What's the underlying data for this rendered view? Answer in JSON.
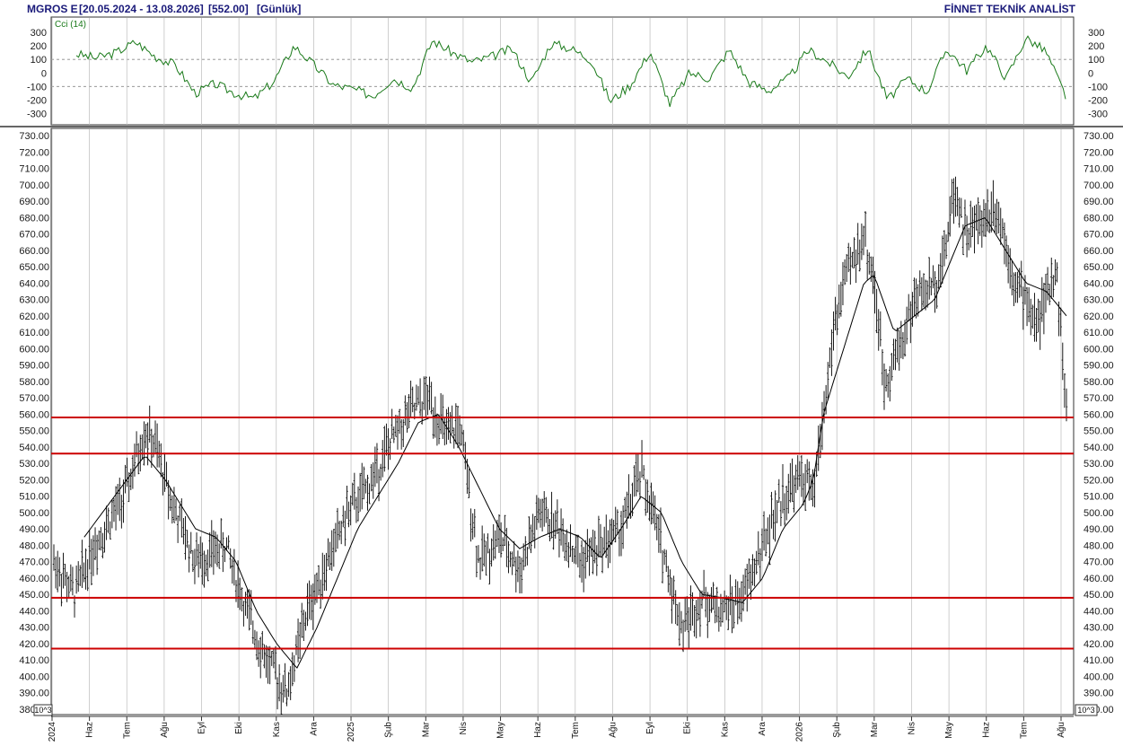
{
  "header": {
    "symbol": "MGROS E",
    "range": "[20.05.2024 - 13.08.2026]",
    "last": "[552.00]",
    "period": "[Günlük]",
    "brand": "FİNNET TEKNİK ANALİST"
  },
  "chart_data": [
    {
      "type": "line",
      "indicator_label": "Cci (14)",
      "ylim": [
        -350,
        380
      ],
      "yticks": [
        300,
        200,
        100,
        0,
        -100,
        -200,
        -300
      ],
      "reference_lines": [
        100,
        -100
      ],
      "series": [
        {
          "name": "Cci (14)",
          "color": "#1a7a1a",
          "points": [
            [
              0,
              140
            ],
            [
              0.02,
              110
            ],
            [
              0.04,
              150
            ],
            [
              0.06,
              230
            ],
            [
              0.08,
              120
            ],
            [
              0.1,
              60
            ],
            [
              0.12,
              -150
            ],
            [
              0.14,
              -80
            ],
            [
              0.16,
              -150
            ],
            [
              0.18,
              -190
            ],
            [
              0.2,
              -60
            ],
            [
              0.22,
              200
            ],
            [
              0.24,
              60
            ],
            [
              0.26,
              -90
            ],
            [
              0.28,
              -120
            ],
            [
              0.3,
              -170
            ],
            [
              0.32,
              -40
            ],
            [
              0.34,
              -110
            ],
            [
              0.36,
              240
            ],
            [
              0.38,
              150
            ],
            [
              0.4,
              80
            ],
            [
              0.42,
              120
            ],
            [
              0.44,
              180
            ],
            [
              0.46,
              -70
            ],
            [
              0.48,
              220
            ],
            [
              0.5,
              180
            ],
            [
              0.52,
              100
            ],
            [
              0.54,
              -210
            ],
            [
              0.56,
              -90
            ],
            [
              0.58,
              160
            ],
            [
              0.6,
              -230
            ],
            [
              0.62,
              0
            ],
            [
              0.64,
              -40
            ],
            [
              0.66,
              170
            ],
            [
              0.68,
              -70
            ],
            [
              0.7,
              -130
            ],
            [
              0.72,
              -40
            ],
            [
              0.74,
              170
            ],
            [
              0.76,
              80
            ],
            [
              0.78,
              -30
            ],
            [
              0.8,
              180
            ],
            [
              0.82,
              -200
            ],
            [
              0.84,
              -40
            ],
            [
              0.86,
              -140
            ],
            [
              0.88,
              180
            ],
            [
              0.9,
              20
            ],
            [
              0.92,
              200
            ],
            [
              0.94,
              -40
            ],
            [
              0.96,
              260
            ],
            [
              0.98,
              160
            ],
            [
              1.0,
              -170
            ]
          ]
        }
      ]
    },
    {
      "type": "bar",
      "style": "ohlc",
      "unit_label": "10^3",
      "ylim": [
        380,
        732
      ],
      "yticks": [
        730,
        720,
        710,
        700,
        690,
        680,
        670,
        660,
        650,
        640,
        630,
        620,
        610,
        600,
        590,
        580,
        570,
        560,
        550,
        540,
        530,
        520,
        510,
        500,
        490,
        480,
        470,
        460,
        450,
        440,
        430,
        420,
        410,
        400,
        390,
        380
      ],
      "horizontal_lines": [
        {
          "y": 558,
          "color": "#cc0000"
        },
        {
          "y": 536,
          "color": "#cc0000"
        },
        {
          "y": 448,
          "color": "#cc0000"
        },
        {
          "y": 417,
          "color": "#cc0000"
        }
      ],
      "x_labels": [
        "2024",
        "Haz",
        "Tem",
        "Ağu",
        "Eyl",
        "Eki",
        "Kas",
        "Ara",
        "2025",
        "Şub",
        "Mar",
        "Nis",
        "May",
        "Haz",
        "Tem",
        "Ağu",
        "Eyl",
        "Eki",
        "Kas",
        "Ara",
        "2026",
        "Şub",
        "Mar",
        "Nis",
        "May",
        "Haz",
        "Tem",
        "Ağu"
      ],
      "price_anchors": [
        [
          0,
          470
        ],
        [
          0.02,
          450
        ],
        [
          0.04,
          480
        ],
        [
          0.07,
          510
        ],
        [
          0.09,
          550
        ],
        [
          0.1,
          540
        ],
        [
          0.12,
          500
        ],
        [
          0.14,
          470
        ],
        [
          0.17,
          480
        ],
        [
          0.19,
          440
        ],
        [
          0.21,
          410
        ],
        [
          0.23,
          390
        ],
        [
          0.25,
          440
        ],
        [
          0.27,
          470
        ],
        [
          0.29,
          500
        ],
        [
          0.31,
          515
        ],
        [
          0.33,
          540
        ],
        [
          0.35,
          560
        ],
        [
          0.37,
          570
        ],
        [
          0.39,
          545
        ],
        [
          0.4,
          555
        ],
        [
          0.42,
          470
        ],
        [
          0.44,
          485
        ],
        [
          0.46,
          465
        ],
        [
          0.48,
          500
        ],
        [
          0.5,
          490
        ],
        [
          0.52,
          470
        ],
        [
          0.54,
          480
        ],
        [
          0.56,
          490
        ],
        [
          0.58,
          525
        ],
        [
          0.6,
          480
        ],
        [
          0.61,
          455
        ],
        [
          0.62,
          430
        ],
        [
          0.64,
          448
        ],
        [
          0.66,
          440
        ],
        [
          0.68,
          447
        ],
        [
          0.7,
          480
        ],
        [
          0.72,
          510
        ],
        [
          0.74,
          522
        ],
        [
          0.75,
          510
        ],
        [
          0.76,
          560
        ],
        [
          0.77,
          610
        ],
        [
          0.78,
          640
        ],
        [
          0.8,
          670
        ],
        [
          0.81,
          640
        ],
        [
          0.82,
          580
        ],
        [
          0.84,
          610
        ],
        [
          0.85,
          630
        ],
        [
          0.87,
          640
        ],
        [
          0.88,
          660
        ],
        [
          0.89,
          700
        ],
        [
          0.9,
          670
        ],
        [
          0.92,
          680
        ],
        [
          0.93,
          690
        ],
        [
          0.95,
          640
        ],
        [
          0.96,
          630
        ],
        [
          0.97,
          615
        ],
        [
          0.98,
          630
        ],
        [
          0.99,
          650
        ],
        [
          1.0,
          560
        ]
      ],
      "sma_anchors": [
        [
          0.03,
          485
        ],
        [
          0.06,
          510
        ],
        [
          0.09,
          535
        ],
        [
          0.11,
          520
        ],
        [
          0.14,
          490
        ],
        [
          0.16,
          485
        ],
        [
          0.18,
          470
        ],
        [
          0.2,
          440
        ],
        [
          0.22,
          420
        ],
        [
          0.24,
          405
        ],
        [
          0.26,
          430
        ],
        [
          0.28,
          460
        ],
        [
          0.3,
          490
        ],
        [
          0.32,
          510
        ],
        [
          0.34,
          530
        ],
        [
          0.36,
          555
        ],
        [
          0.38,
          560
        ],
        [
          0.4,
          540
        ],
        [
          0.42,
          515
        ],
        [
          0.44,
          490
        ],
        [
          0.46,
          478
        ],
        [
          0.48,
          485
        ],
        [
          0.5,
          490
        ],
        [
          0.52,
          485
        ],
        [
          0.54,
          472
        ],
        [
          0.56,
          490
        ],
        [
          0.58,
          510
        ],
        [
          0.6,
          500
        ],
        [
          0.62,
          470
        ],
        [
          0.64,
          450
        ],
        [
          0.66,
          448
        ],
        [
          0.68,
          445
        ],
        [
          0.7,
          460
        ],
        [
          0.72,
          490
        ],
        [
          0.74,
          505
        ],
        [
          0.75,
          520
        ],
        [
          0.76,
          560
        ],
        [
          0.78,
          600
        ],
        [
          0.8,
          640
        ],
        [
          0.81,
          645
        ],
        [
          0.83,
          610
        ],
        [
          0.85,
          620
        ],
        [
          0.87,
          630
        ],
        [
          0.88,
          645
        ],
        [
          0.9,
          675
        ],
        [
          0.92,
          680
        ],
        [
          0.94,
          660
        ],
        [
          0.96,
          640
        ],
        [
          0.98,
          635
        ],
        [
          1.0,
          620
        ]
      ]
    }
  ]
}
